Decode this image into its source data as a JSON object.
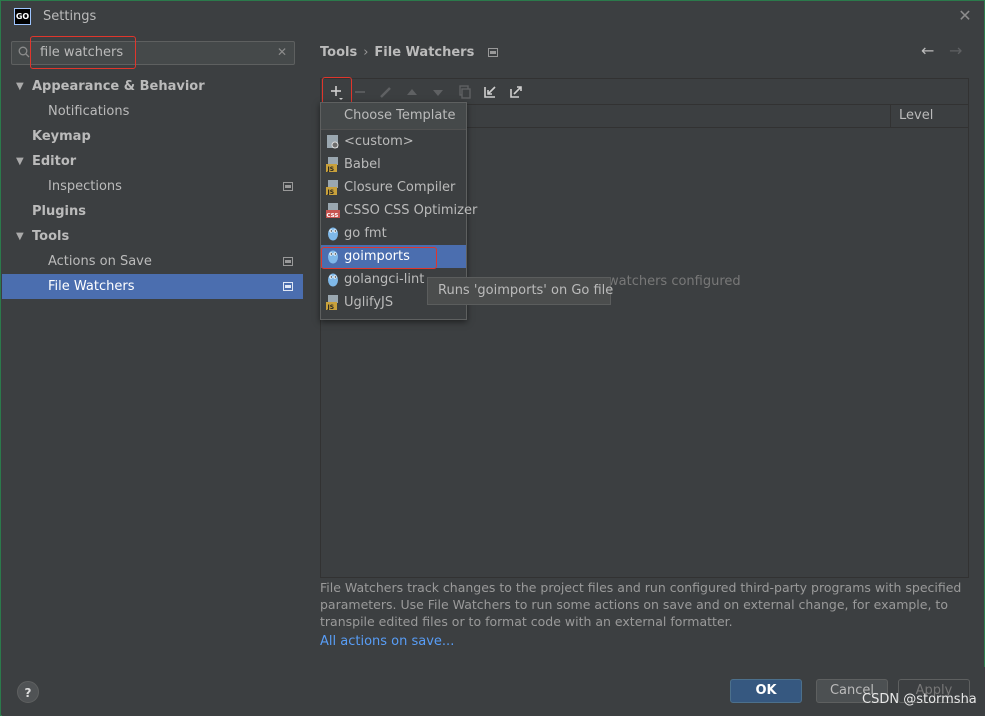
{
  "window": {
    "title": "Settings",
    "app_icon_text": "GO"
  },
  "search": {
    "value": "file watchers"
  },
  "tree": [
    {
      "label": "Appearance & Behavior",
      "bold": true,
      "expanded": true
    },
    {
      "label": "Notifications"
    },
    {
      "label": "Keymap",
      "bold": true
    },
    {
      "label": "Editor",
      "bold": true,
      "expanded": true
    },
    {
      "label": "Inspections",
      "badge": true
    },
    {
      "label": "Plugins",
      "bold": true
    },
    {
      "label": "Tools",
      "bold": true,
      "expanded": true
    },
    {
      "label": "Actions on Save",
      "badge": true
    },
    {
      "label": "File Watchers",
      "badge": true,
      "selected": true
    }
  ],
  "breadcrumb": {
    "parent": "Tools",
    "sep": "›",
    "current": "File Watchers"
  },
  "table": {
    "col_level": "Level",
    "empty_text": "watchers configured"
  },
  "dropdown": {
    "header": "Choose Template",
    "items": [
      {
        "label": "<custom>",
        "icon": "custom-watcher-icon"
      },
      {
        "label": "Babel",
        "icon": "js-watcher-icon"
      },
      {
        "label": "Closure Compiler",
        "icon": "js-watcher-icon"
      },
      {
        "label": "CSSO CSS Optimizer",
        "icon": "css-watcher-icon"
      },
      {
        "label": "go fmt",
        "icon": "gopher-icon"
      },
      {
        "label": "goimports",
        "icon": "gopher-icon",
        "selected": true
      },
      {
        "label": "golangci-lint",
        "icon": "gopher-icon"
      },
      {
        "label": "UglifyJS",
        "icon": "js-watcher-icon"
      }
    ]
  },
  "tooltip": "Runs 'goimports' on Go file",
  "description": "File Watchers track changes to the project files and run configured third-party programs with specified parameters. Use File Watchers to run some actions on save and on external change, for example, to transpile edited files or to format code with an external formatter.",
  "link": "All actions on save...",
  "buttons": {
    "help": "?",
    "ok": "OK",
    "cancel": "Cancel",
    "apply": "Apply"
  },
  "watermark": "CSDN @stormsha",
  "colors": {
    "selection": "#4b6eaf",
    "highlight_box": "#e0362c",
    "link": "#589df6"
  }
}
